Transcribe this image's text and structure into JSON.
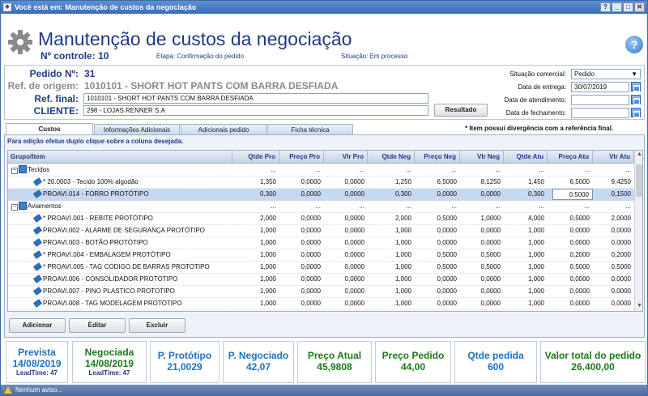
{
  "window": {
    "title": "Você está em: Manutenção de custos da negociação",
    "buttons": {
      "help": "?",
      "minimize": "_",
      "maximize": "□",
      "close": "✕"
    }
  },
  "header": {
    "title": "Manutenção de custos da negociação",
    "controle_label": "Nº controle:",
    "controle_value": "10",
    "etapa": "Etapa:  Confirmação do pedido",
    "situacao": "Situação:  Em processo",
    "help": "?"
  },
  "info": {
    "pedido_label": "Pedido Nº:",
    "pedido_value": "31",
    "ref_origem_label": "Ref. de origem:",
    "ref_origem_value": "1010101 - SHORT HOT PANTS COM BARRA DESFIADA",
    "ref_final_label": "Ref. final:",
    "ref_final_value": "1010101 - SHORT HOT PANTS COM BARRA DESFIADA",
    "cliente_label": "CLIENTE:",
    "cliente_value": "298 - LOJAS RENNER S.A",
    "resultado_button": "Resultado",
    "situacao_comercial_label": "Situação comercial:",
    "situacao_comercial_value": "Pedido",
    "data_entrega_label": "Data de entrega:",
    "data_entrega_value": "30/07/2019",
    "data_atendimento_label": "Data de atendimento:",
    "data_atendimento_value": "",
    "data_fechamento_label": "Data de fechamento:",
    "data_fechamento_value": ""
  },
  "tabs": [
    "Custos",
    "Informações Adicionais",
    "Adicionais pedido",
    "Ficha técnica"
  ],
  "divergence_note": "* Item possui divergência com a referência final.",
  "hint": "Para edição efetue duplo clique sobre a coluna desejada.",
  "grid": {
    "columns": [
      "Grupo/Item",
      "Qtde Pro",
      "Preço Pro",
      "Vlr Pro",
      "Qtde Neg",
      "Preço Neg",
      "Vlr Neg",
      "Qtde Atu",
      "Preço Atu",
      "Vlr Atu"
    ],
    "rows": [
      {
        "type": "group",
        "name": "Tecidos",
        "toggle": "−",
        "cells": [
          "...",
          "...",
          "...",
          "...",
          "...",
          "...",
          "...",
          "...",
          "..."
        ]
      },
      {
        "type": "item",
        "name": "* 20.0003 - Tecido 100% algodão",
        "cells": [
          "1,350",
          "0,0000",
          "0,0000",
          "1,250",
          "6,5000",
          "8,1250",
          "1,450",
          "6,5000",
          "9,4250"
        ]
      },
      {
        "type": "item",
        "name": "PROAVI.014 - FORRO PROTÓTIPO",
        "selected": true,
        "cells": [
          "0,300",
          "0,0000",
          "0,0000",
          "0,300",
          "0,0000",
          "0,0000",
          "0,300",
          "0,5000",
          "0,1500"
        ]
      },
      {
        "type": "group",
        "name": "Aviamentos",
        "toggle": "−",
        "cells": [
          "...",
          "...",
          "...",
          "...",
          "...",
          "...",
          "...",
          "...",
          "..."
        ]
      },
      {
        "type": "item",
        "name": "* PROAVI.001 - REBITE PROTÓTIPO",
        "cells": [
          "2,000",
          "0,0000",
          "0,0000",
          "2,000",
          "0,5000",
          "1,0000",
          "4,000",
          "0,5000",
          "2,0000"
        ]
      },
      {
        "type": "item",
        "name": "PROAVI.002 - ALARME DE SEGURANÇA PROTÓTIPO",
        "cells": [
          "1,000",
          "0,0000",
          "0,0000",
          "1,000",
          "0,0000",
          "0,0000",
          "1,000",
          "0,0000",
          "0,0000"
        ]
      },
      {
        "type": "item",
        "name": "PROAVI.003 - BOTÃO PROTÓTIPO",
        "cells": [
          "1,000",
          "0,0000",
          "0,0000",
          "1,000",
          "0,0000",
          "0,0000",
          "1,000",
          "0,0000",
          "0,0000"
        ]
      },
      {
        "type": "item",
        "name": "* PROAVI.004 - EMBALAGEM PROTÓTIPO",
        "cells": [
          "1,000",
          "0,0000",
          "0,0000",
          "1,000",
          "0,5000",
          "0,5000",
          "1,000",
          "0,2000",
          "0,2000"
        ]
      },
      {
        "type": "item",
        "name": "* PROAVI.005 - TAG CODIGO DE BARRAS PROTOTIPO",
        "cells": [
          "1,000",
          "0,0000",
          "0,0000",
          "1,000",
          "0,5000",
          "0,5000",
          "1,000",
          "0,5000",
          "0,5000"
        ]
      },
      {
        "type": "item",
        "name": "PROAVI.006 - CONSOLIDADOR PROTOTIPO",
        "cells": [
          "1,000",
          "0,0000",
          "0,0000",
          "1,000",
          "0,0000",
          "0,0000",
          "1,000",
          "0,0000",
          "0,0000"
        ]
      },
      {
        "type": "item",
        "name": "PROAVI.007 - PINO PLASTICO PROTOTIPO",
        "cells": [
          "1,000",
          "0,0000",
          "0,0000",
          "1,000",
          "0,0000",
          "0,0000",
          "1,000",
          "0,0000",
          "0,0000"
        ]
      },
      {
        "type": "item",
        "name": "PROAVI.008 - TAG MODELAGEM PROTÓTIPO",
        "cells": [
          "1,000",
          "0,0000",
          "0,0000",
          "1,000",
          "0,0000",
          "0,0000",
          "1,000",
          "0,0000",
          "0,0000"
        ]
      }
    ]
  },
  "actions": {
    "add": "Adicionar",
    "edit": "Editar",
    "delete": "Excluir"
  },
  "summary": [
    {
      "title": "Prevista",
      "value": "14/08/2019",
      "sub": "LeadTime: 47",
      "color": "blue"
    },
    {
      "title": "Negociada",
      "value": "14/08/2019",
      "sub": "LeadTime: 47",
      "color": "green"
    },
    {
      "title": "P. Protótipo",
      "value": "21,0029",
      "color": "blue"
    },
    {
      "title": "P. Negociado",
      "value": "42,07",
      "color": "blue"
    },
    {
      "title": "Preço Atual",
      "value": "45,9808",
      "color": "green"
    },
    {
      "title": "Preço Pedido",
      "value": "44,00",
      "color": "green"
    },
    {
      "title": "Qtde pedida",
      "value": "600",
      "color": "blue"
    },
    {
      "title": "Valor total do pedido",
      "value": "26.400,00",
      "color": "green"
    }
  ],
  "status": "Nenhum aviso..."
}
